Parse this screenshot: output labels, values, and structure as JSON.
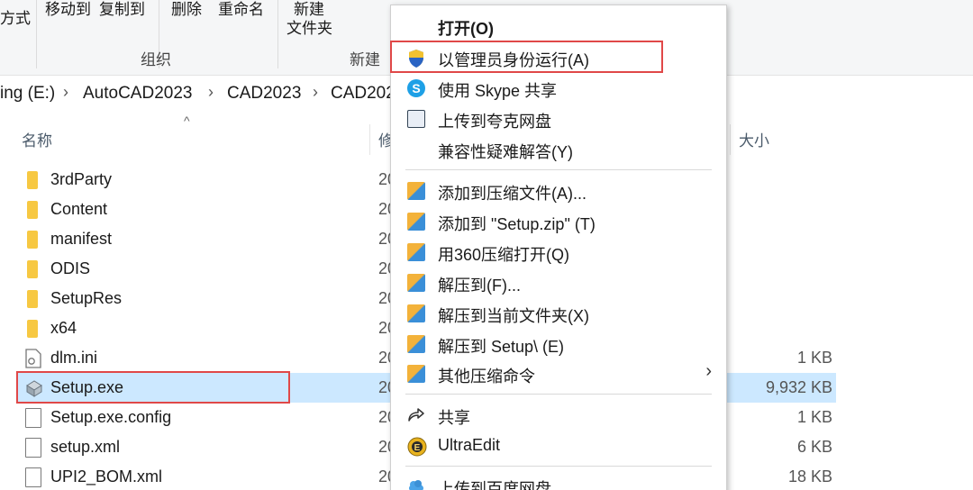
{
  "ribbon": {
    "labels": {
      "view_mode": "方式",
      "move_to": "移动到",
      "copy_to": "复制到",
      "delete": "删除",
      "rename": "重命名",
      "new_folder_line1": "新建",
      "new_folder_line2": "文件夹"
    },
    "groups": {
      "organize": "组织",
      "new": "新建"
    }
  },
  "address_bar": {
    "crumbs": [
      "ing (E:)",
      "AutoCAD2023",
      "CAD2023",
      "CAD202"
    ]
  },
  "columns": {
    "name": "名称",
    "modified": "修",
    "size": "大小"
  },
  "files": [
    {
      "name": "3rdParty",
      "date": "20",
      "size": "",
      "type": "folder"
    },
    {
      "name": "Content",
      "date": "20",
      "size": "",
      "type": "folder"
    },
    {
      "name": "manifest",
      "date": "20",
      "size": "",
      "type": "folder"
    },
    {
      "name": "ODIS",
      "date": "20",
      "size": "",
      "type": "folder"
    },
    {
      "name": "SetupRes",
      "date": "20",
      "size": "",
      "type": "folder"
    },
    {
      "name": "x64",
      "date": "20",
      "size": "",
      "type": "folder"
    },
    {
      "name": "dlm.ini",
      "date": "20",
      "size": "1 KB",
      "type": "ini"
    },
    {
      "name": "Setup.exe",
      "date": "20",
      "size": "9,932 KB",
      "type": "exe",
      "selected": true
    },
    {
      "name": "Setup.exe.config",
      "date": "20",
      "size": "1 KB",
      "type": "file"
    },
    {
      "name": "setup.xml",
      "date": "20",
      "size": "6 KB",
      "type": "file"
    },
    {
      "name": "UPI2_BOM.xml",
      "date": "20",
      "size": "18 KB",
      "type": "file"
    }
  ],
  "context_menu": {
    "items": [
      {
        "label": "打开(O)",
        "icon": "none",
        "bold": true
      },
      {
        "label": "以管理员身份运行(A)",
        "icon": "shield-icon"
      },
      {
        "label": "使用 Skype 共享",
        "icon": "skype-icon"
      },
      {
        "label": "上传到夸克网盘",
        "icon": "cloud-upload-icon"
      },
      {
        "label": "兼容性疑难解答(Y)",
        "icon": "none"
      },
      {
        "label": "添加到压缩文件(A)...",
        "icon": "archive-icon"
      },
      {
        "label": "添加到 \"Setup.zip\" (T)",
        "icon": "archive-icon"
      },
      {
        "label": "用360压缩打开(Q)",
        "icon": "archive-icon"
      },
      {
        "label": "解压到(F)...",
        "icon": "archive-icon"
      },
      {
        "label": "解压到当前文件夹(X)",
        "icon": "archive-icon"
      },
      {
        "label": "解压到 Setup\\ (E)",
        "icon": "archive-icon"
      },
      {
        "label": "其他压缩命令",
        "icon": "archive-icon",
        "submenu": true
      },
      {
        "label": "共享",
        "icon": "share-icon"
      },
      {
        "label": "UltraEdit",
        "icon": "ultraedit-icon"
      },
      {
        "label": "上传到百度网盘",
        "icon": "baidu-cloud-icon"
      }
    ]
  },
  "colors": {
    "selection": "#cce8ff",
    "highlight_border": "#e04848",
    "folder": "#f7c842"
  }
}
